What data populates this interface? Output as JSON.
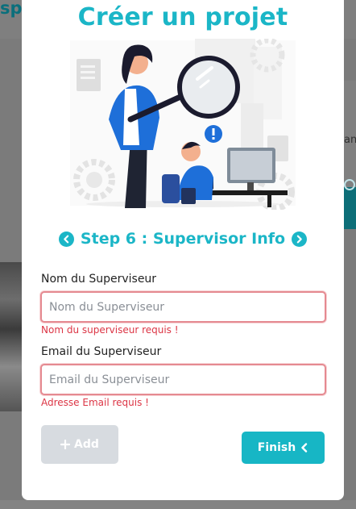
{
  "background": {
    "partial_text_top_left": "spa",
    "partial_text_right": "ant"
  },
  "modal": {
    "title": "Créer un projet",
    "step_label": "Step 6 : Supervisor Info",
    "fields": [
      {
        "label": "Nom du Superviseur",
        "placeholder": "Nom du Superviseur",
        "value": "",
        "error": "Nom du superviseur requis !"
      },
      {
        "label": "Email du Superviseur",
        "placeholder": "Email du Superviseur",
        "value": "",
        "error": "Adresse Email requis !"
      }
    ],
    "add_button_label": "Add",
    "finish_button_label": "Finish"
  },
  "colors": {
    "accent": "#1bb6c7",
    "error": "#dc3545",
    "invalid_border": "#e58a91",
    "disabled_button": "#d7dbe0"
  },
  "icons": {
    "prev_step": "chevron-left-circle-icon",
    "next_step": "chevron-right-circle-icon",
    "add": "plus-icon",
    "finish": "chevron-left-icon"
  }
}
